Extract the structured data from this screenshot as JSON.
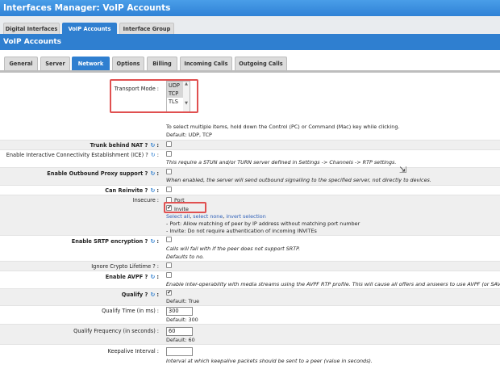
{
  "window": {
    "title": "Interfaces Manager:  VoIP Accounts"
  },
  "main_tabs": [
    {
      "label": "Digital Interfaces",
      "active": false
    },
    {
      "label": "VoIP Accounts",
      "active": true
    },
    {
      "label": "Interface Group",
      "active": false
    }
  ],
  "section": {
    "title": "VoIP Accounts"
  },
  "sub_tabs": [
    {
      "label": "General",
      "active": false
    },
    {
      "label": "Server",
      "active": false
    },
    {
      "label": "Network",
      "active": true
    },
    {
      "label": "Options",
      "active": false
    },
    {
      "label": "Billing",
      "active": false
    },
    {
      "label": "Incoming Calls",
      "active": false
    },
    {
      "label": "Outgoing Calls",
      "active": false
    }
  ],
  "transport": {
    "label": "Transport Mode",
    "options": [
      "UDP",
      "TCP",
      "TLS"
    ],
    "selected": [
      "UDP",
      "TCP"
    ],
    "help": "To select multiple items, hold down the Control (PC) or Command (Mac) key while clicking.",
    "default": "Default: UDP, TCP"
  },
  "trunk_nat": {
    "label": "Trunk behind NAT ?",
    "checked": false
  },
  "ice": {
    "label": "Enable Interactive Connectivity Establishment (ICE) ?",
    "checked": false,
    "help": "This require a STUN and/or TURN server defined in Settings -> Channels -> RTP settings."
  },
  "outbound_proxy": {
    "label": "Enable Outbound Proxy support ?",
    "checked": false,
    "help": "When enabled, the server will send outbound signalling to the specified server, not directly to devices."
  },
  "can_reinvite": {
    "label": "Can Reinvite ?",
    "checked": false
  },
  "insecure": {
    "label": "Insecure",
    "options": [
      {
        "label": "Port",
        "checked": false
      },
      {
        "label": "Invite",
        "checked": true
      }
    ],
    "select_all": "Select all",
    "select_none": "select none",
    "invert": "invert selection",
    "help_port": "- Port: Allow matching of peer by IP address without matching port number",
    "help_invite": "- Invite: Do not require authentication of incoming INVITEs"
  },
  "srtp": {
    "label": "Enable SRTP encryption ?",
    "checked": false,
    "help": "Calls will fail with if the peer does not support SRTP.",
    "default": "Defaults to no."
  },
  "ignore_crypto": {
    "label": "Ignore Crypto Lifetime ?",
    "checked": false
  },
  "avpf": {
    "label": "Enable AVPF ?",
    "checked": false,
    "help": "Enable inter-operability with media streams using the AVPF RTP profile. This will cause all offers and answers to use AVPF (or SAVPF)."
  },
  "qualify": {
    "label": "Qualify ?",
    "checked": true,
    "default": "Default: True"
  },
  "qualify_time": {
    "label": "Qualify Time (in ms)",
    "value": "300",
    "default": "Default: 300"
  },
  "qualify_freq": {
    "label": "Qualify Frequency (in seconds)",
    "value": "60",
    "default": "Default: 60"
  },
  "keepalive": {
    "label": "Keepalive Interval",
    "value": "",
    "help": "Interval at which keepalive packets should be sent to a peer (value in seconds)."
  }
}
